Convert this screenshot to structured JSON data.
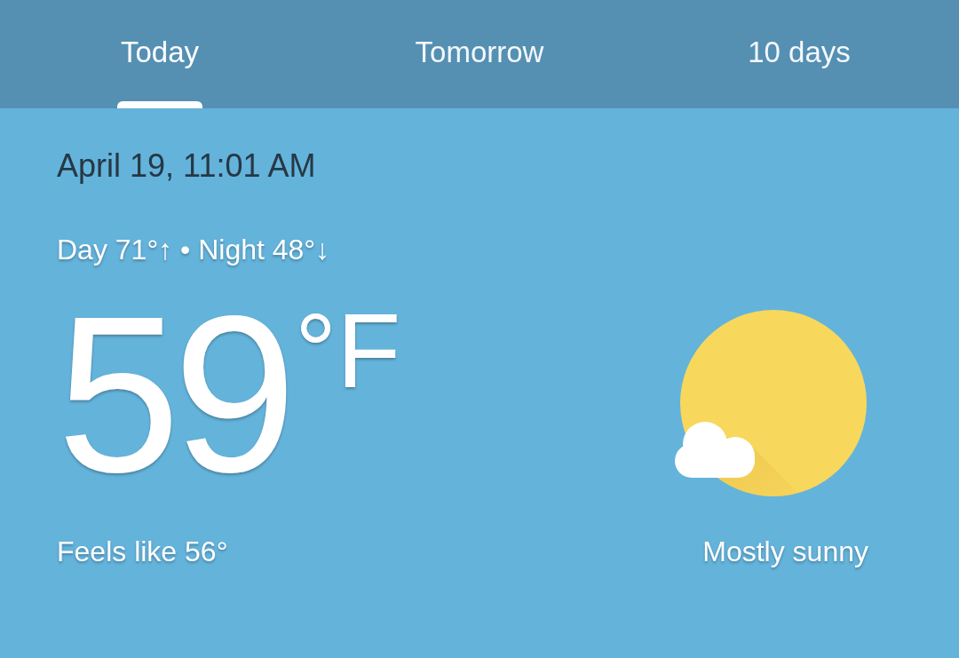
{
  "tabs": [
    {
      "label": "Today",
      "selected": true
    },
    {
      "label": "Tomorrow",
      "selected": false
    },
    {
      "label": "10 days",
      "selected": false
    }
  ],
  "current": {
    "datetime": "April 19, 11:01 AM",
    "day_night": "Day 71°↑ • Night 48°↓",
    "temperature": "59",
    "unit": "°F",
    "feels_like": "Feels like 56°",
    "condition": "Mostly sunny"
  }
}
